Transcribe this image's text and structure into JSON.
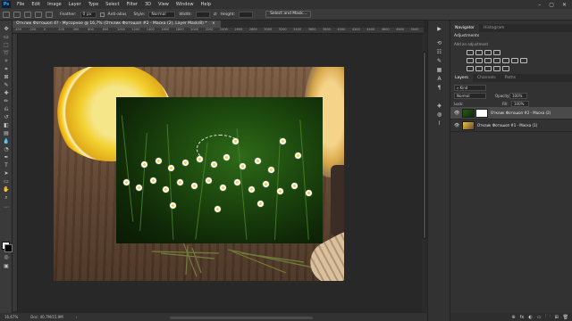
{
  "app": {
    "logo": "Ps"
  },
  "menu": [
    "File",
    "Edit",
    "Image",
    "Layer",
    "Type",
    "Select",
    "Filter",
    "3D",
    "View",
    "Window",
    "Help"
  ],
  "window_controls": [
    "–",
    "▢",
    "✕"
  ],
  "options_bar": {
    "feather_label": "Feather:",
    "feather_value": "0 px",
    "antialias_label": "Anti-alias",
    "style_label": "Style:",
    "style_value": "Normal",
    "width_label": "Width:",
    "height_label": "Height:",
    "select_mask_label": "Select and Mask..."
  },
  "document_tab": {
    "title": "Отклик Фотошоп 4? - Мусорное @ 16,7% (Отклик Фотошоп #2 - Маска (2), Layer Mask/8) *",
    "close": "×"
  },
  "rulers": {
    "top_ticks": [
      "-400",
      "-200",
      "0",
      "200",
      "400",
      "600",
      "800",
      "1000",
      "1200",
      "1400",
      "1600",
      "1800",
      "2000",
      "2200",
      "2400",
      "2600",
      "2800",
      "3000",
      "3200",
      "3400",
      "3600",
      "3800",
      "4000",
      "4200",
      "4400",
      "4600",
      "4800",
      "5000"
    ]
  },
  "status_bar": {
    "zoom": "16,67%",
    "doc": "Doc: 40,7M/15,9M",
    "arrow": "›"
  },
  "navigator_tabs": [
    "Navigator",
    "Histogram"
  ],
  "adjustments": {
    "title": "Adjustments",
    "subtitle": "Add an adjustment"
  },
  "layers_tabs": [
    "Layers",
    "Channels",
    "Paths"
  ],
  "layers_panel": {
    "filter_label": "Kind",
    "blend_mode": "Normal",
    "opacity_label": "Opacity:",
    "opacity_value": "100%",
    "lock_label": "Lock:",
    "fill_label": "Fill:",
    "fill_value": "100%",
    "layers": [
      {
        "name": "Отклик Фотошоп #2 - Маска (2)",
        "selected": true
      },
      {
        "name": "Отклик Фотошоп #1 - Маска (1)",
        "selected": false
      }
    ]
  },
  "panel_footer_icons": [
    "⊕",
    "fx",
    "◐",
    "▭",
    "🗀",
    "⊞",
    "🗑"
  ],
  "colors": {
    "accent": "#31a8ff",
    "chrome": "#323232",
    "canvas": "#282828"
  }
}
